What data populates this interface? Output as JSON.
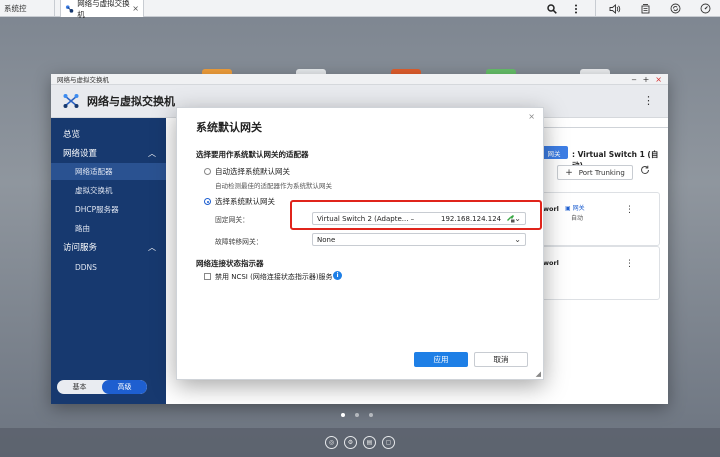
{
  "taskbar": {
    "prev_tab": "系统控",
    "active_tab": "网络与虚拟交换机",
    "close_glyph": "×",
    "icons": [
      "search-icon",
      "more-icon",
      "volume-icon",
      "notification-icon",
      "sync-icon",
      "dashboard-icon"
    ]
  },
  "window": {
    "titlebar_label": "网络与虚拟交换机",
    "app_title": "网络与虚拟交换机",
    "controls": [
      "‒",
      "+",
      "×"
    ],
    "menu_glyph": "⋮"
  },
  "sidebar": {
    "overview": "总览",
    "network_settings": "网络设置",
    "network_adapter": "网络适配器",
    "virtual_switch": "虚拟交换机",
    "dhcp_server": "DHCP服务器",
    "routing": "路由",
    "access_services": "访问服务",
    "ddns": "DDNS",
    "chevron": "︿",
    "mode_basic": "基本",
    "mode_advanced": "高级"
  },
  "background_main": {
    "vs_chip": "网关",
    "vs_title": ": Virtual Switch 1 (自动)",
    "port_trunking": "Port Trunking",
    "card1_partial": "worl",
    "card1_gw": "网关",
    "card1_gw_sub": "自动",
    "card2_partial": "worl",
    "dots": "⋮"
  },
  "dialog": {
    "title": "系统默认网关",
    "close_glyph": "×",
    "section_adapter": "选择要用作系统默认网关的适配器",
    "opt_auto_label": "自动选择系统默认网关",
    "opt_auto_desc": "自动检测最佳的适配器作为系统默认网关",
    "opt_manual_label": "选择系统默认网关",
    "fixed_gateway_label": "固定网关：",
    "fixed_gateway_value": "Virtual Switch 2 (Adapte... –",
    "fixed_gateway_ip": "192.168.124.124",
    "failover_label": "故障转移网关：",
    "failover_value": "None",
    "section_ncsi": "网络连接状态指示器",
    "ncsi_checkbox_label": "禁用 NCSI (网络连接状态指示器)服务",
    "info_glyph": "i",
    "apply_label": "应用",
    "cancel_label": "取消"
  },
  "colors": {
    "sidebar_bg": "#17396f",
    "accent": "#1e7fe6",
    "highlight": "#e0241b"
  }
}
